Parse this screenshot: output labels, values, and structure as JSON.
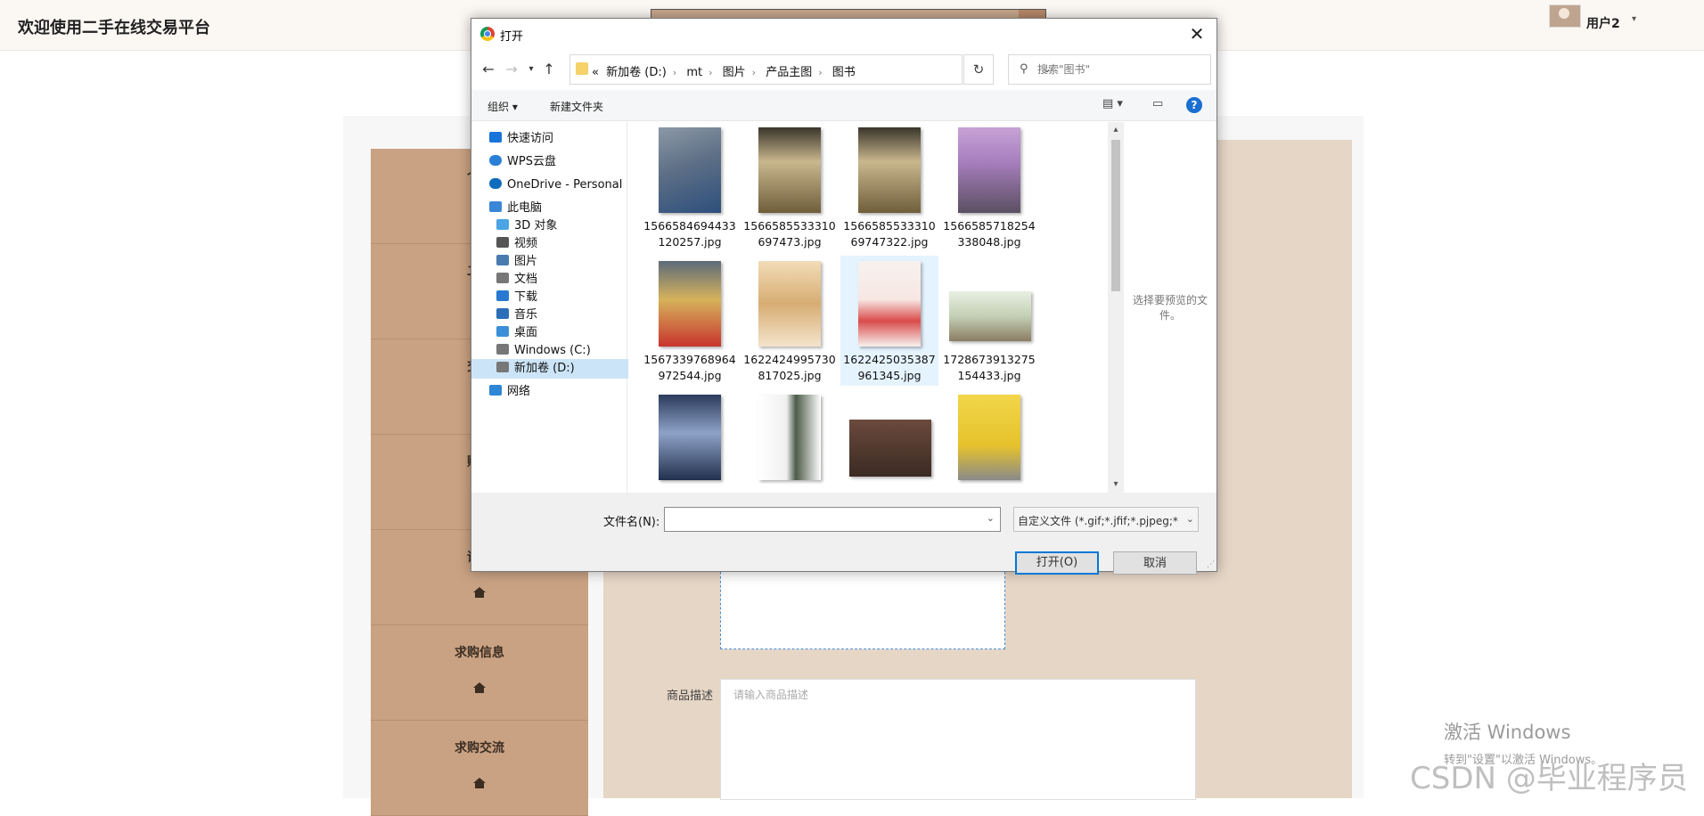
{
  "header": {
    "site_title": "欢迎使用二手在线交易平台",
    "user_name": "用户2"
  },
  "sidebar": {
    "items": [
      {
        "label": "个人"
      },
      {
        "label": "二手"
      },
      {
        "label": "交流"
      },
      {
        "label": "购买"
      },
      {
        "label": "评价"
      },
      {
        "label": "求购信息"
      },
      {
        "label": "求购交流"
      }
    ]
  },
  "form": {
    "upload_plus": "+",
    "desc_label": "商品描述",
    "desc_placeholder": "请输入商品描述"
  },
  "dialog": {
    "title": "打开",
    "close": "✕",
    "breadcrumb": [
      "«",
      "新加卷 (D:)",
      "mt",
      "图片",
      "产品主图",
      "图书"
    ],
    "search_placeholder": "搜索\"图书\"",
    "toolbar": {
      "organize": "组织 ▾",
      "new_folder": "新建文件夹"
    },
    "nav_items": [
      {
        "label": "快速访问",
        "icon": "star-icon"
      },
      {
        "label": "WPS云盘",
        "icon": "cloud-icon"
      },
      {
        "label": "OneDrive - Personal",
        "icon": "onedrive-icon"
      },
      {
        "label": "此电脑",
        "icon": "computer-icon"
      },
      {
        "label": "3D 对象",
        "icon": "cube-icon"
      },
      {
        "label": "视频",
        "icon": "video-icon"
      },
      {
        "label": "图片",
        "icon": "image-icon"
      },
      {
        "label": "文档",
        "icon": "document-icon"
      },
      {
        "label": "下载",
        "icon": "download-icon"
      },
      {
        "label": "音乐",
        "icon": "music-icon"
      },
      {
        "label": "桌面",
        "icon": "desktop-icon"
      },
      {
        "label": "Windows (C:)",
        "icon": "drive-icon"
      },
      {
        "label": "新加卷 (D:)",
        "icon": "drive-icon"
      },
      {
        "label": "网络",
        "icon": "network-icon"
      }
    ],
    "files": [
      {
        "name": "1566584694433120257.jpg"
      },
      {
        "name": "1566585533310697473.jpg"
      },
      {
        "name": "156658553331069747322.jpg"
      },
      {
        "name": "1566585718254338048.jpg"
      },
      {
        "name": "1567339768964972544.jpg"
      },
      {
        "name": "1622424995730817025.jpg"
      },
      {
        "name": "1622425035387961345.jpg"
      },
      {
        "name": "1728673913275154433.jpg"
      },
      {
        "name": ""
      },
      {
        "name": ""
      },
      {
        "name": ""
      },
      {
        "name": ""
      }
    ],
    "preview_text": "选择要预览的文件。",
    "filename_label": "文件名(N):",
    "filename_value": "",
    "filter_text": "自定义文件 (*.gif;*.jfif;*.pjpeg;*",
    "open_button": "打开(O)",
    "cancel_button": "取消"
  },
  "watermark": {
    "activate_title": "激活 Windows",
    "activate_sub": "转到\"设置\"以激活 Windows。",
    "csdn": "CSDN @毕业程序员"
  },
  "colors": {
    "sidebar": "#c9a283",
    "content_bg": "#e6d6c6",
    "accent_blue": "#0078d7"
  }
}
